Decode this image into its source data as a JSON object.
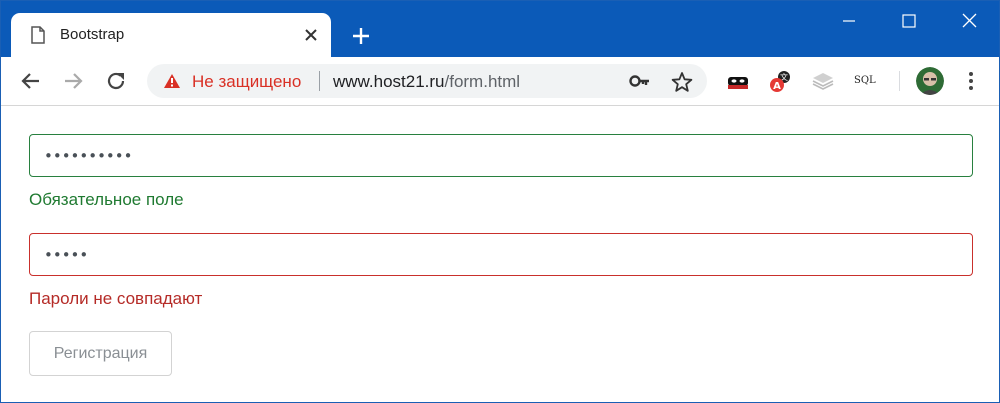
{
  "colors": {
    "titlebar": "#0b5ab8",
    "valid": "#28803f",
    "invalid": "#c9302c",
    "security_warning": "#d93025"
  },
  "tab": {
    "title": "Bootstrap",
    "icon": "document-icon"
  },
  "omnibox": {
    "security_label": "Не защищено",
    "url_host": "www.host21.ru",
    "url_path": "/form.html"
  },
  "extensions": [
    {
      "icon": "mask-extension-icon"
    },
    {
      "icon": "translate-extension-icon",
      "badge": "A"
    },
    {
      "icon": "layers-extension-icon"
    },
    {
      "icon": "sql-extension-icon",
      "label": "SQL"
    }
  ],
  "form": {
    "password": {
      "value": "••••••••••",
      "state": "valid",
      "feedback": "Обязательное поле"
    },
    "confirm_password": {
      "value": "•••••",
      "state": "invalid",
      "feedback": "Пароли не совпадают"
    },
    "submit_label": "Регистрация"
  }
}
